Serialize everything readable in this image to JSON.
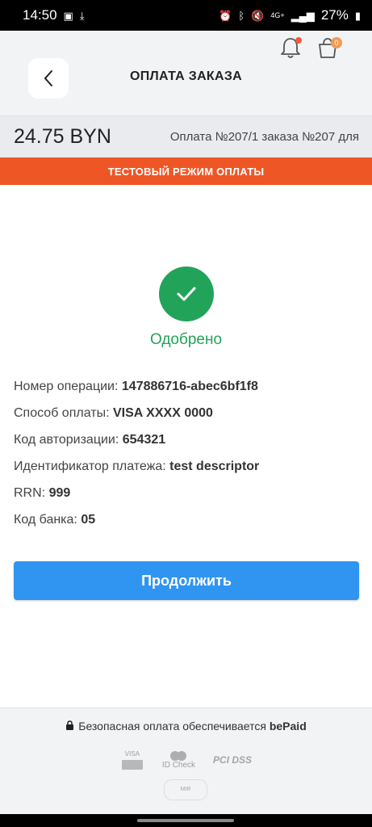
{
  "statusbar": {
    "time": "14:50",
    "battery": "27%",
    "network": "4G+"
  },
  "header": {
    "title": "ОПЛАТА ЗАКАЗА",
    "cart_count": "0"
  },
  "order": {
    "amount": "24.75 BYN",
    "description": "Оплата №207/1 заказа №207 для"
  },
  "banner": {
    "text": "ТЕСТОВЫЙ РЕЖИМ ОПЛАТЫ"
  },
  "result": {
    "status": "Одобрено",
    "status_color": "#22a35a"
  },
  "details": [
    {
      "label": "Номер операции:",
      "value": "147886716-abec6bf1f8"
    },
    {
      "label": "Способ оплаты:",
      "value": "VISA XXXX 0000"
    },
    {
      "label": "Код авторизации:",
      "value": "654321"
    },
    {
      "label": "Идентификатор платежа:",
      "value": "test descriptor"
    },
    {
      "label": "RRN:",
      "value": "999"
    },
    {
      "label": "Код банка:",
      "value": "05"
    }
  ],
  "actions": {
    "continue_label": "Продолжить",
    "continue_color": "#2f95f0"
  },
  "footer": {
    "secure_text": "Безопасная оплата обеспечивается",
    "provider": "bePaid",
    "logo_visa": "VISA",
    "logo_idcheck": "ID Check",
    "logo_pci": "PCI DSS",
    "logo_mir": "MIR"
  },
  "colors": {
    "banner": "#ef5626",
    "header_bg": "#f2f3f5"
  }
}
